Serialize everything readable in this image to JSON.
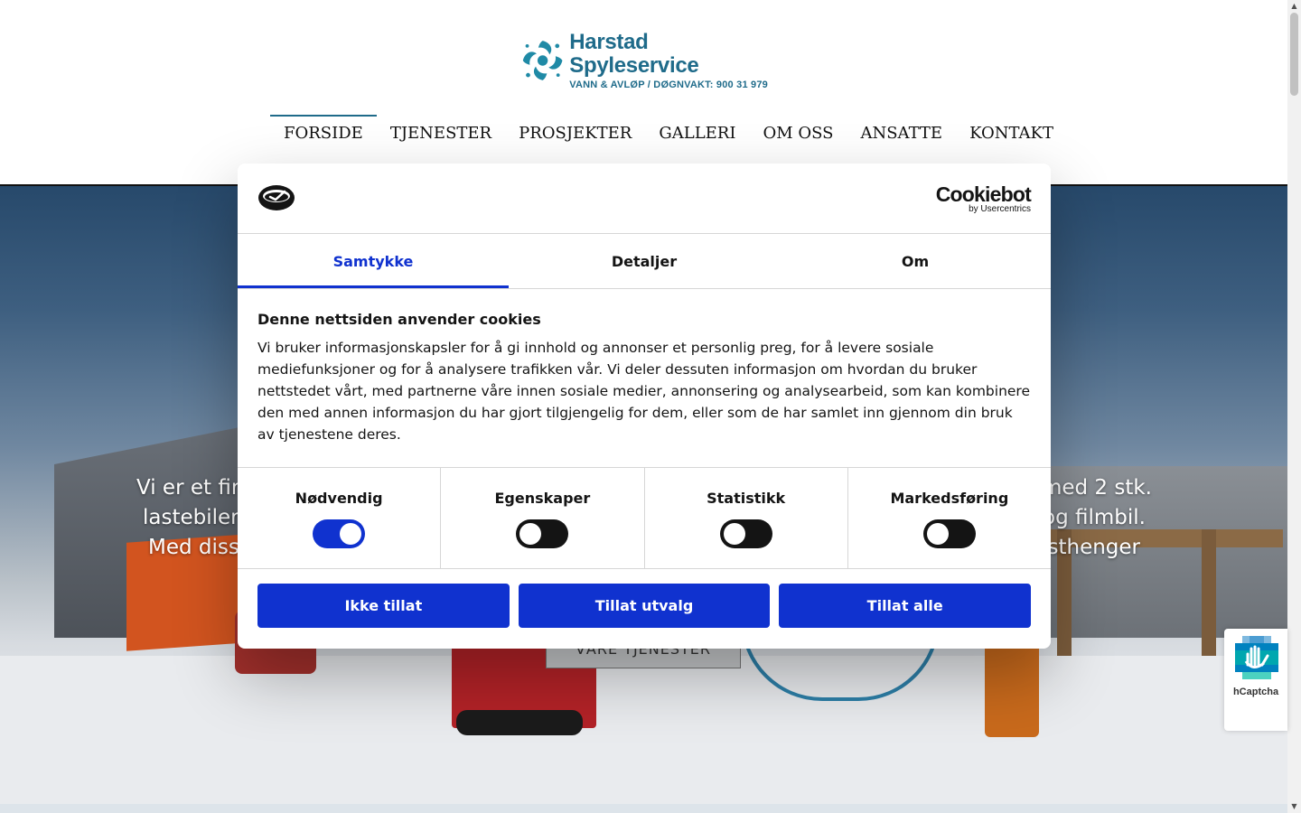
{
  "header": {
    "logo": {
      "name": "Harstad Spyleservice",
      "tagline": "VANN & AVLØP / DØGNVAKT: 900 31 979"
    },
    "nav": [
      {
        "label": "FORSIDE",
        "active": true
      },
      {
        "label": "TJENESTER"
      },
      {
        "label": "PROSJEKTER"
      },
      {
        "label": "GALLERI"
      },
      {
        "label": "OM OSS"
      },
      {
        "label": "ANSATTE"
      },
      {
        "label": "KONTAKT"
      }
    ]
  },
  "hero": {
    "line1_left": "Vi er et fir",
    "line1_right": "med 2 stk.",
    "line2_left": "lastebiler",
    "line2_right": "og filmbil.",
    "line3_left": "Med diss",
    "line3_right": "sthenger",
    "cta_label": "VÅRE TJENESTER"
  },
  "cookie_dialog": {
    "brand": {
      "name": "Cookiebot",
      "by": "by Usercentrics"
    },
    "tabs": [
      {
        "label": "Samtykke",
        "active": true
      },
      {
        "label": "Detaljer"
      },
      {
        "label": "Om"
      }
    ],
    "title": "Denne nettsiden anvender cookies",
    "text": "Vi bruker informasjonskapsler for å gi innhold og annonser et personlig preg, for å levere sosiale mediefunksjoner og for å analysere trafikken vår. Vi deler dessuten informasjon om hvordan du bruker nettstedet vårt, med partnerne våre innen sosiale medier, annonsering og analysearbeid, som kan kombinere den med annen informasjon du har gjort tilgjengelig for dem, eller som de har samlet inn gjennom din bruk av tjenestene deres.",
    "toggles": [
      {
        "label": "Nødvendig",
        "checked": true
      },
      {
        "label": "Egenskaper",
        "checked": false
      },
      {
        "label": "Statistikk",
        "checked": false
      },
      {
        "label": "Markedsføring",
        "checked": false
      }
    ],
    "buttons": {
      "deny": "Ikke tillat",
      "allow_selection": "Tillat utvalg",
      "allow_all": "Tillat alle"
    },
    "accent_color": "#1032cf"
  },
  "hcaptcha": {
    "label": "hCaptcha"
  },
  "colors": {
    "brand": "#1f6b8a",
    "cookie_accent": "#1032cf"
  }
}
